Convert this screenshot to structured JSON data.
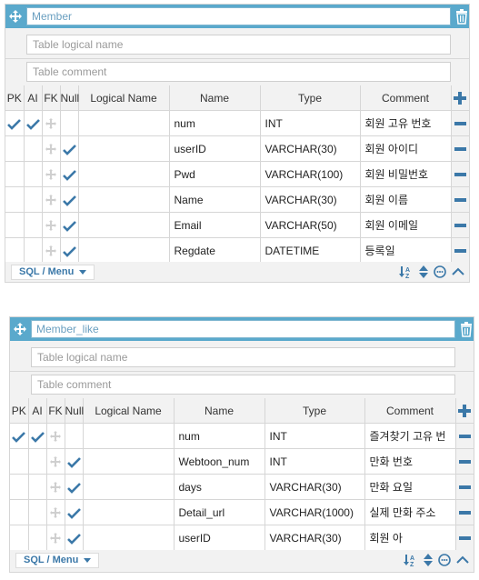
{
  "tables": [
    {
      "name": "Member",
      "logical_placeholder": "Table logical name",
      "comment_placeholder": "Table comment",
      "columns": {
        "pk": "PK",
        "ai": "AI",
        "fk": "FK",
        "null": "Null",
        "logical": "Logical Name",
        "name": "Name",
        "type": "Type",
        "comment": "Comment"
      },
      "rows": [
        {
          "pk": true,
          "ai": true,
          "fk": true,
          "null": false,
          "name": "num",
          "type": "INT",
          "comment": "회원 고유 번호"
        },
        {
          "pk": false,
          "ai": false,
          "fk": true,
          "null": true,
          "name": "userID",
          "type": "VARCHAR(30)",
          "comment": "회원 아이디"
        },
        {
          "pk": false,
          "ai": false,
          "fk": true,
          "null": true,
          "name": "Pwd",
          "type": "VARCHAR(100)",
          "comment": "회원 비밀번호"
        },
        {
          "pk": false,
          "ai": false,
          "fk": true,
          "null": true,
          "name": "Name",
          "type": "VARCHAR(30)",
          "comment": "회원 이름"
        },
        {
          "pk": false,
          "ai": false,
          "fk": true,
          "null": true,
          "name": "Email",
          "type": "VARCHAR(50)",
          "comment": "회원 이메일"
        },
        {
          "pk": false,
          "ai": false,
          "fk": true,
          "null": true,
          "name": "Regdate",
          "type": "DATETIME",
          "comment": "등록일"
        }
      ],
      "menu_label": "SQL / Menu"
    },
    {
      "name": "Member_like",
      "logical_placeholder": "Table logical name",
      "comment_placeholder": "Table comment",
      "columns": {
        "pk": "PK",
        "ai": "AI",
        "fk": "FK",
        "null": "Null",
        "logical": "Logical Name",
        "name": "Name",
        "type": "Type",
        "comment": "Comment"
      },
      "rows": [
        {
          "pk": true,
          "ai": true,
          "fk": true,
          "null": false,
          "name": "num",
          "type": "INT",
          "comment": "즐겨찾기 고유 번"
        },
        {
          "pk": false,
          "ai": false,
          "fk": true,
          "null": true,
          "name": "Webtoon_num",
          "type": "INT",
          "comment": "만화 번호"
        },
        {
          "pk": false,
          "ai": false,
          "fk": true,
          "null": true,
          "name": "days",
          "type": "VARCHAR(30)",
          "comment": "만화 요일"
        },
        {
          "pk": false,
          "ai": false,
          "fk": true,
          "null": true,
          "name": "Detail_url",
          "type": "VARCHAR(1000)",
          "comment": "실제 만화 주소"
        },
        {
          "pk": false,
          "ai": false,
          "fk": true,
          "null": true,
          "name": "userID",
          "type": "VARCHAR(30)",
          "comment": "회원 아"
        }
      ],
      "menu_label": "SQL / Menu"
    }
  ],
  "icons": {
    "move": "move-icon",
    "trash": "trash-icon",
    "add": "add-column-icon",
    "remove": "remove-column-icon",
    "check": "check-icon",
    "fk": "foreign-key-icon",
    "sort": "sort-az-icon",
    "updown": "up-down-icon",
    "comment": "comment-icon",
    "collapse": "chevron-up-icon"
  },
  "colors": {
    "header": "#5aa9cc",
    "accent": "#3b78a8",
    "check": "#3b78a8"
  }
}
